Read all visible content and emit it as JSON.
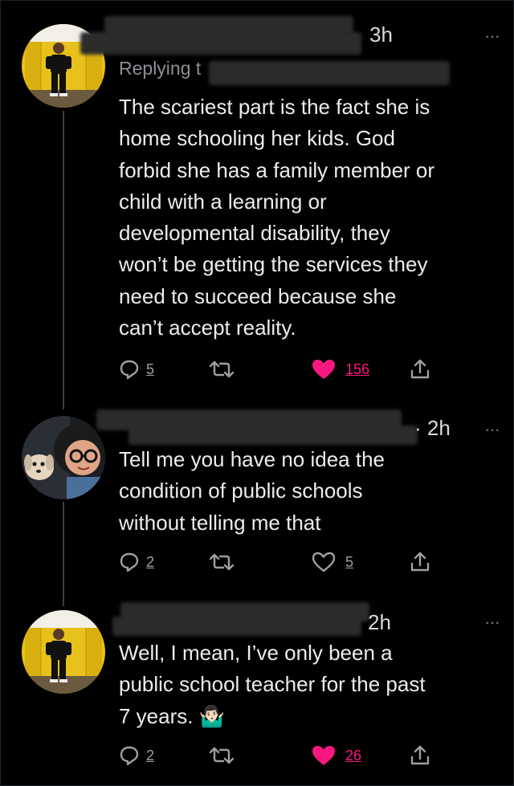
{
  "colors": {
    "background": "#000000",
    "text": "#ececec",
    "muted": "#71767b",
    "like_pink": "#f91880",
    "thread_line": "#3a3d41",
    "redaction": "#2b2b2b"
  },
  "tweets": [
    {
      "avatar": "man-in-school-hallway-avatar",
      "timestamp": "3h",
      "replying_prefix": "Replying t",
      "text_lines": [
        "The scariest part is the fact she is",
        "home schooling her kids. God",
        "forbid she has a family member or",
        "child with a learning or",
        "developmental disability, they",
        "won’t be getting the services they",
        "need to succeed because she",
        "can’t accept reality."
      ],
      "reply_count": "5",
      "like_count": "156",
      "liked": true
    },
    {
      "avatar": "woman-with-glasses-and-dog-avatar",
      "timestamp": "· 2h",
      "text_lines": [
        "Tell me you have no idea the",
        "condition of public schools",
        "without telling me that"
      ],
      "reply_count": "2",
      "like_count": "5",
      "liked": false
    },
    {
      "avatar": "man-in-school-hallway-avatar",
      "timestamp": "2h",
      "text_lines": [
        "Well, I mean, I’ve only been a",
        "public school teacher for the past",
        "7 years. 🤷🏻‍♂️"
      ],
      "reply_count": "2",
      "like_count": "26",
      "liked": true
    }
  ],
  "more_label": "···"
}
